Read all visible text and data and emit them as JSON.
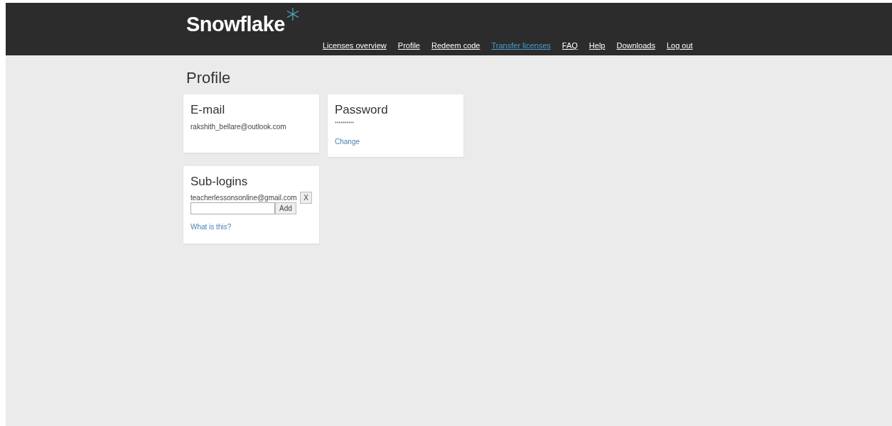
{
  "header": {
    "logo": "Snowflake",
    "nav": [
      {
        "label": "Licenses overview",
        "selected": false
      },
      {
        "label": "Profile",
        "selected": false
      },
      {
        "label": "Redeem code",
        "selected": false
      },
      {
        "label": "Transfer licenses",
        "selected": true
      },
      {
        "label": "FAQ",
        "selected": false
      },
      {
        "label": "Help",
        "selected": false
      },
      {
        "label": "Downloads",
        "selected": false
      },
      {
        "label": "Log out",
        "selected": false
      }
    ]
  },
  "page_title": "Profile",
  "email_card": {
    "title": "E-mail",
    "value": "rakshith_bellare@outlook.com"
  },
  "password_card": {
    "title": "Password",
    "value": "**********",
    "link": "Change"
  },
  "sublogins_card": {
    "title": "Sub-logins",
    "entries": [
      {
        "email": "teacherlessonsonline@gmail.com",
        "remove": "X"
      }
    ],
    "add_button": "Add",
    "link": "What is this?"
  }
}
